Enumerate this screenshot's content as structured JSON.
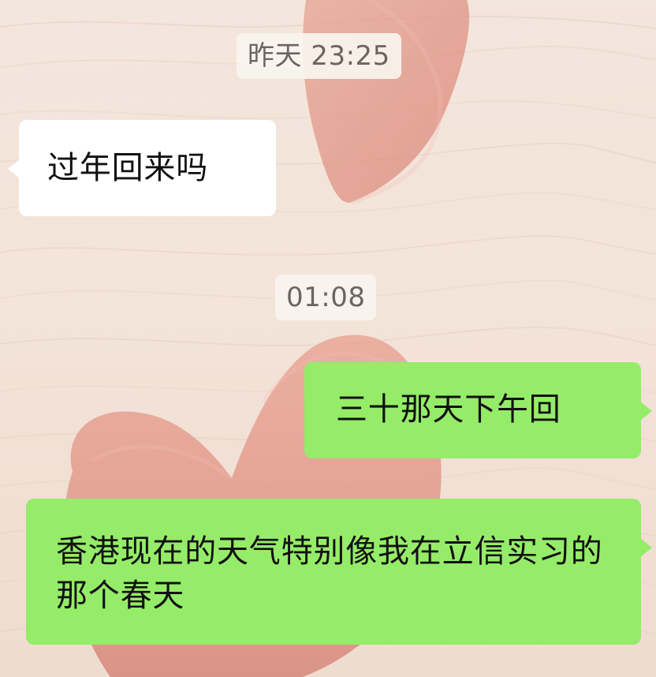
{
  "chat": {
    "background_color": "#f1dfd2",
    "incoming_bubble_color": "#ffffff",
    "outgoing_bubble_color": "#95ec69",
    "timestamps": [
      {
        "text": "昨天 23:25"
      },
      {
        "text": "01:08"
      }
    ],
    "messages": [
      {
        "side": "incoming",
        "text": "过年回来吗"
      },
      {
        "side": "outgoing",
        "text": "三十那天下午回"
      },
      {
        "side": "outgoing",
        "text": "香港现在的天气特别像我在立信实习的那个春天"
      }
    ],
    "background_decoration": {
      "icon": "heart-illustration"
    }
  }
}
